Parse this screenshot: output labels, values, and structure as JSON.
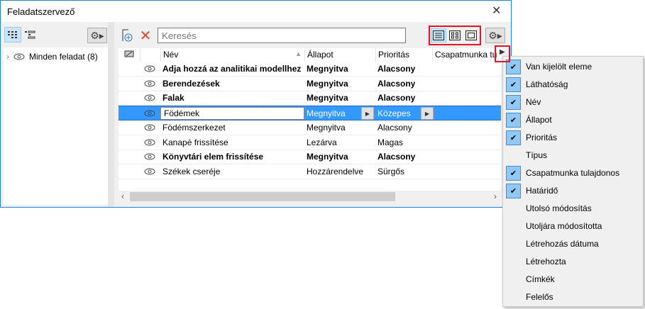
{
  "window": {
    "title": "Feladatszervező",
    "close": "✕"
  },
  "left": {
    "tree_item": "Minden feladat (8)"
  },
  "toolbar": {
    "search_placeholder": "Keresés"
  },
  "table": {
    "columns": [
      "Név",
      "Állapot",
      "Prioritás",
      "Csapatmunka tu"
    ],
    "rows": [
      {
        "name": "Adja hozzá az analitikai modellhez",
        "state": "Megnyitva",
        "priority": "Alacsony",
        "bold": true
      },
      {
        "name": "Berendezések",
        "state": "Megnyitva",
        "priority": "Alacsony",
        "bold": true
      },
      {
        "name": "Falak",
        "state": "Megnyitva",
        "priority": "Alacsony",
        "bold": true
      },
      {
        "name": "Födémek",
        "state": "Megnyitva",
        "priority": "Közepes",
        "selected": true
      },
      {
        "name": "Födémszerkezet",
        "state": "Megnyitva",
        "priority": "Alacsony"
      },
      {
        "name": "Kanapé frissítése",
        "state": "Lezárva",
        "priority": "Magas"
      },
      {
        "name": "Könyvtári elem frissítése",
        "state": "Megnyitva",
        "priority": "Alacsony",
        "bold": true
      },
      {
        "name": "Székek cseréje",
        "state": "Hozzárendelve",
        "priority": "Sürgős"
      }
    ]
  },
  "menu": {
    "items": [
      {
        "label": "Van kijelölt eleme",
        "checked": true
      },
      {
        "label": "Láthatóság",
        "checked": true
      },
      {
        "label": "Név",
        "checked": true
      },
      {
        "label": "Állapot",
        "checked": true
      },
      {
        "label": "Prioritás",
        "checked": true
      },
      {
        "label": "Típus",
        "checked": false
      },
      {
        "label": "Csapatmunka tulajdonos",
        "checked": true
      },
      {
        "label": "Határidő",
        "checked": true
      },
      {
        "label": "Utolsó módosítás",
        "checked": false
      },
      {
        "label": "Utoljára módosította",
        "checked": false
      },
      {
        "label": "Létrehozás dátuma",
        "checked": false
      },
      {
        "label": "Létrehozta",
        "checked": false
      },
      {
        "label": "Címkék",
        "checked": false
      },
      {
        "label": "Felelős",
        "checked": false
      }
    ]
  }
}
